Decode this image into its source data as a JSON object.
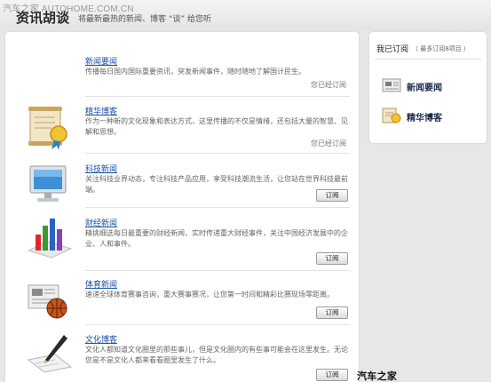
{
  "header": {
    "watermark": "汽车之家 AUTOHOME.COM.CN",
    "logo": "资讯胡谈",
    "tagline": "将最新最热的新闻、博客 “谈” 给您听"
  },
  "feeds": [
    {
      "icon": "newspaper-icon",
      "title": "新闻要闻",
      "desc": "传播每日国内国际重要资讯，突发新闻事件，随时随地了解国计民生。",
      "status": "您已经订阅",
      "button": ""
    },
    {
      "icon": "award-scroll-icon",
      "title": "精华博客",
      "desc": "作为一种新的文化现象和表达方式，这里传播的不仅是情绪，还包括大量的智慧、见解和思想。",
      "status": "您已经订阅",
      "button": ""
    },
    {
      "icon": "monitor-icon",
      "title": "科技新闻",
      "desc": "关注科技业界动态，专注科技产品应用，享受科技潮流生活，让您站在世界科技最前端。",
      "status": "",
      "button": "订阅"
    },
    {
      "icon": "bar-chart-icon",
      "title": "财经新闻",
      "desc": "精挑细选每日最重要的财经新闻，实时传递重大财经事件，关注中国经济发展中的企业、人和事件。",
      "status": "",
      "button": "订阅"
    },
    {
      "icon": "basketball-icon",
      "title": "体育新闻",
      "desc": "速递全球体育赛事咨询，重大赛事赛况，让您第一时间和精彩比赛现场零距离。",
      "status": "",
      "button": "订阅"
    },
    {
      "icon": "pen-icon",
      "title": "文化博客",
      "desc": "文化人都知道文化圈里的那些事儿，但是文化圈内的有些事可能会在这里发生。无论您是不是文化人都来看看圈里发生了什么。",
      "status": "",
      "button": "订阅"
    }
  ],
  "sidebar": {
    "title": "我已订阅",
    "count": "（ 最多订阅8项目 ）",
    "subscriptions": [
      {
        "icon": "newspaper-icon",
        "label": "新闻要闻"
      },
      {
        "icon": "award-scroll-icon",
        "label": "精华博客"
      }
    ]
  },
  "footer": {
    "watermark": "汽车之家 AUTOHOME.COM.CN"
  },
  "colors": {
    "link": "#1a4fa3",
    "background": "#e7e7e7",
    "panel": "#ffffff"
  }
}
